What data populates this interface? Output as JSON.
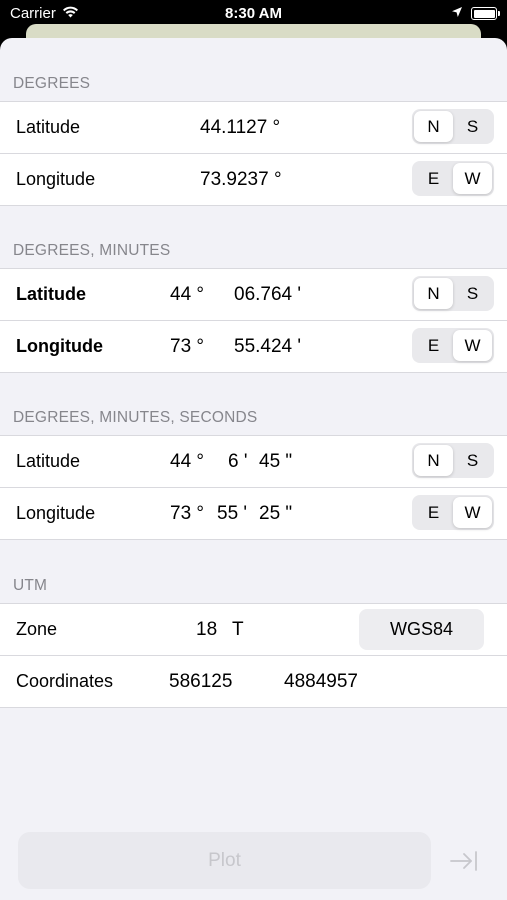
{
  "status_bar": {
    "carrier": "Carrier",
    "time": "8:30 AM",
    "icons": [
      "wifi-icon",
      "location-arrow-icon",
      "battery-icon"
    ]
  },
  "sections": {
    "degrees": {
      "header": "DEGREES",
      "latitude": {
        "label": "Latitude",
        "value": "44.1127 °",
        "options": [
          "N",
          "S"
        ],
        "selected": "N"
      },
      "longitude": {
        "label": "Longitude",
        "value": "73.9237 °",
        "options": [
          "E",
          "W"
        ],
        "selected": "W"
      }
    },
    "degrees_minutes": {
      "header": "DEGREES, MINUTES",
      "latitude": {
        "label": "Latitude",
        "degrees": "44 °",
        "minutes": "06.764 '",
        "options": [
          "N",
          "S"
        ],
        "selected": "N"
      },
      "longitude": {
        "label": "Longitude",
        "degrees": "73 °",
        "minutes": "55.424 '",
        "options": [
          "E",
          "W"
        ],
        "selected": "W"
      }
    },
    "degrees_minutes_seconds": {
      "header": "DEGREES, MINUTES, SECONDS",
      "latitude": {
        "label": "Latitude",
        "degrees": "44 °",
        "minutes": "6 '",
        "seconds": "45 \"",
        "options": [
          "N",
          "S"
        ],
        "selected": "N"
      },
      "longitude": {
        "label": "Longitude",
        "degrees": "73 °",
        "minutes": "55 '",
        "seconds": "25 \"",
        "options": [
          "E",
          "W"
        ],
        "selected": "W"
      }
    },
    "utm": {
      "header": "UTM",
      "zone": {
        "label": "Zone",
        "number": "18",
        "band": "T",
        "datum_button": "WGS84"
      },
      "coordinates": {
        "label": "Coordinates",
        "easting": "586125",
        "northing": "4884957"
      }
    }
  },
  "footer": {
    "plot_button": "Plot",
    "plot_icon": "arrow-right-to-bar-icon"
  },
  "colors": {
    "background": "#f2f2f7",
    "header_text": "#86868c",
    "disabled_text": "#c7c7cc"
  }
}
